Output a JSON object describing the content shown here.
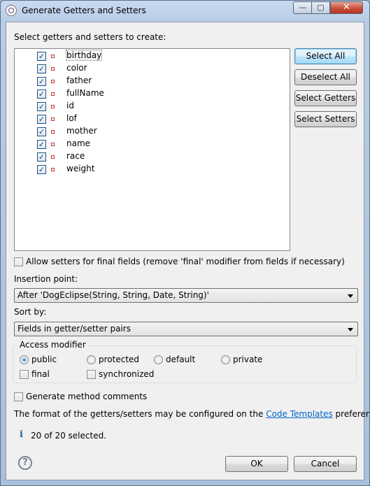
{
  "window": {
    "title": "Generate Getters and Setters",
    "min_glyph": "—",
    "max_glyph": "▢",
    "close_glyph": "✕"
  },
  "list": {
    "label": "Select getters and setters to create:",
    "items": [
      {
        "label": "birthday",
        "checked": true
      },
      {
        "label": "color",
        "checked": true
      },
      {
        "label": "father",
        "checked": true
      },
      {
        "label": "fullName",
        "checked": true
      },
      {
        "label": "id",
        "checked": true
      },
      {
        "label": "lof",
        "checked": true
      },
      {
        "label": "mother",
        "checked": true
      },
      {
        "label": "name",
        "checked": true
      },
      {
        "label": "race",
        "checked": true
      },
      {
        "label": "weight",
        "checked": true
      }
    ],
    "field_icon": "private-field-icon",
    "field_icon_color": "#c83232"
  },
  "side_buttons": {
    "select_all": "Select All",
    "deselect_all": "Deselect All",
    "select_getters": "Select Getters",
    "select_setters": "Select Setters"
  },
  "allow_final": {
    "label": "Allow setters for final fields (remove 'final' modifier from fields if necessary)",
    "checked": false
  },
  "insertion_point": {
    "label": "Insertion point:",
    "value": "After 'DogEclipse(String, String, Date, String)'"
  },
  "sort_by": {
    "label": "Sort by:",
    "value": "Fields in getter/setter pairs"
  },
  "access_modifier": {
    "title": "Access modifier",
    "options": [
      "public",
      "protected",
      "default",
      "private"
    ],
    "selected": "public",
    "final_label": "final",
    "final_checked": false,
    "synchronized_label": "synchronized",
    "synchronized_checked": false
  },
  "generate_comments": {
    "label": "Generate method comments",
    "checked": false
  },
  "footer_text": {
    "prefix": "The format of the getters/setters may be configured on the ",
    "link": "Code Templates",
    "suffix": " preference page."
  },
  "status": {
    "icon": "info-icon",
    "icon_glyph": "i",
    "text": "20 of 20 selected."
  },
  "bottom_buttons": {
    "ok": "OK",
    "cancel": "Cancel",
    "help_icon": "help-icon",
    "help_glyph": "?"
  },
  "colors": {
    "accent": "#3c7fb1",
    "link": "#0066cc",
    "window_frame": "#b8cce6"
  }
}
